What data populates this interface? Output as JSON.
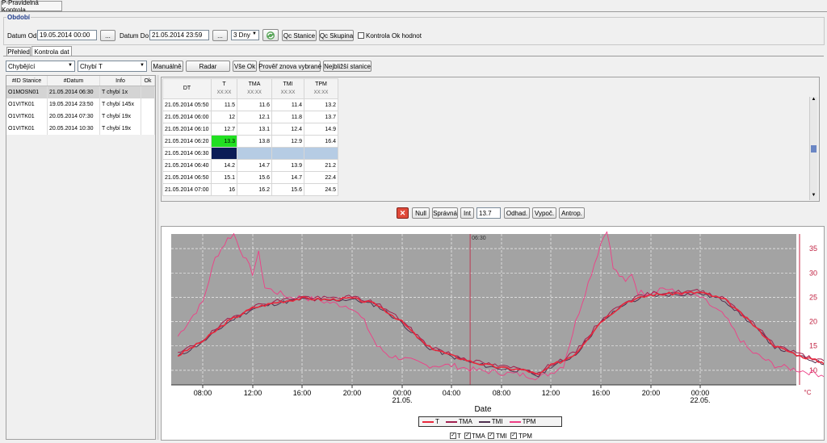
{
  "window": {
    "tab_title": "P-Pravidelná Kontrola"
  },
  "period": {
    "group_label": "Období",
    "from_label": "Datum Od",
    "from_value": "19.05.2014 00:00",
    "to_label": "Datum Do",
    "to_value": "21.05.2014 23:59",
    "ellipsis": "...",
    "range_select": "3 Dny",
    "qc_station": "Qc Stanice",
    "qc_group": "Qc Skupina",
    "ok_values_label": "Kontrola Ok hodnot"
  },
  "tabs": [
    "Přehled",
    "Kontrola dat"
  ],
  "toolbar": {
    "filter_select": "Chybějící",
    "column_select": "Chybí T",
    "manual": "Manuálně",
    "radar": "Radar",
    "all_ok": "Vše Ok",
    "recheck": "Prověř znova vybrané",
    "nearest": "Nejbližší stanice"
  },
  "list": {
    "headers": [
      "#ID Stanice",
      "#Datum",
      "Info",
      "Ok"
    ],
    "rows": [
      [
        "O1MOSN01",
        "21.05.2014 06:30",
        "T chybí 1x",
        ""
      ],
      [
        "O1VITK01",
        "19.05.2014 23:50",
        "T chybí 145x",
        ""
      ],
      [
        "O1VITK01",
        "20.05.2014 07:30",
        "T chybí 19x",
        ""
      ],
      [
        "O1VITK01",
        "20.05.2014 10:30",
        "T chybí 19x",
        ""
      ]
    ]
  },
  "grid": {
    "headers": [
      {
        "name": "DT",
        "sub": ""
      },
      {
        "name": "T",
        "sub": "XX:XX"
      },
      {
        "name": "TMA",
        "sub": "XX:XX"
      },
      {
        "name": "TMI",
        "sub": "XX:XX"
      },
      {
        "name": "TPM",
        "sub": "XX:XX"
      }
    ],
    "rows": [
      [
        "21.05.2014 05:50",
        "11.5",
        "11.6",
        "11.4",
        "13.2"
      ],
      [
        "21.05.2014 06:00",
        "12",
        "12.1",
        "11.8",
        "13.7"
      ],
      [
        "21.05.2014 06:10",
        "12.7",
        "13.1",
        "12.4",
        "14.9"
      ],
      [
        "21.05.2014 06:20",
        "13.3",
        "13.8",
        "12.9",
        "16.4"
      ],
      [
        "21.05.2014 06:30",
        "",
        "",
        "",
        ""
      ],
      [
        "21.05.2014 06:40",
        "14.2",
        "14.7",
        "13.9",
        "21.2"
      ],
      [
        "21.05.2014 06:50",
        "15.1",
        "15.6",
        "14.7",
        "22.4"
      ],
      [
        "21.05.2014 07:00",
        "16",
        "16.2",
        "15.6",
        "24.5"
      ]
    ]
  },
  "actions": {
    "delete_icon": "delete-x-icon",
    "null": "Null",
    "correct": "Správná",
    "int": "Int",
    "int_value": "13.7",
    "estimate": "Odhad.",
    "compute": "Vypoč.",
    "antrop": "Antrop."
  },
  "chart_data": {
    "type": "line",
    "xlabel": "Date",
    "ylabel": "°C",
    "marker_label": "06:30",
    "x_ticks": [
      "08:00",
      "12:00",
      "16:00",
      "20:00",
      "00:00",
      "04:00",
      "08:00",
      "12:00",
      "16:00",
      "20:00",
      "00:00"
    ],
    "date_ticks": [
      "21.05.",
      "22.05."
    ],
    "y_ticks": [
      10,
      15,
      20,
      25,
      30,
      35
    ],
    "ylim": [
      7,
      38
    ],
    "grid": true,
    "legend_position": "bottom",
    "series": [
      {
        "name": "T",
        "color": "#e8283c"
      },
      {
        "name": "TMA",
        "color": "#a02050"
      },
      {
        "name": "TMI",
        "color": "#503050"
      },
      {
        "name": "TPM",
        "color": "#ee3f86"
      }
    ],
    "legend_checks": [
      "T",
      "TMA",
      "TMI",
      "TPM"
    ]
  }
}
